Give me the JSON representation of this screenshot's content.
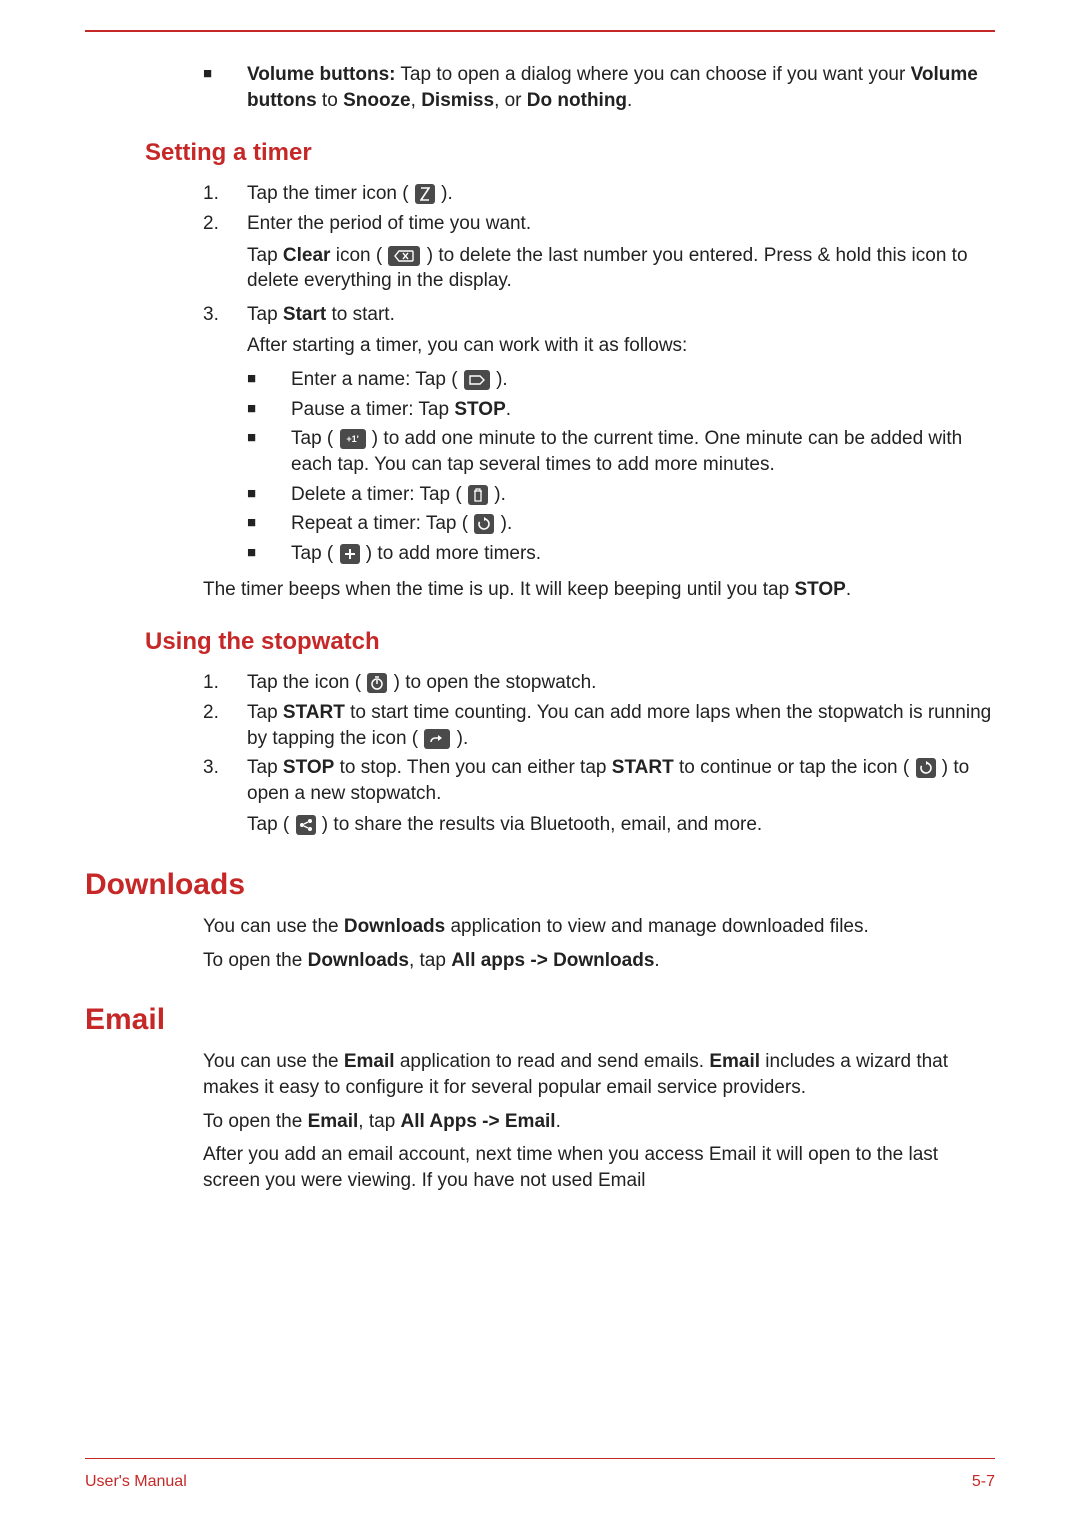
{
  "footer": {
    "left": "User's Manual",
    "right": "5-7"
  },
  "top_bullet": {
    "vb_bold": "Volume buttons:",
    "vb_text1": " Tap to open a dialog where you can choose if you want your ",
    "vb_text2_bold": "Volume buttons",
    "vb_text3": " to ",
    "vb_snooze": "Snooze",
    "vb_c1": ", ",
    "vb_dismiss": "Dismiss",
    "vb_c2": ", or ",
    "vb_donothing": "Do nothing",
    "vb_period": "."
  },
  "setting_timer": {
    "heading": "Setting a timer",
    "step1_a": "Tap the timer icon ( ",
    "step1_b": " ).",
    "step2": "Enter the period of time you want.",
    "step2_p_a": "Tap ",
    "step2_p_clear": "Clear",
    "step2_p_b": " icon ( ",
    "step2_p_c": " ) to delete the last number you entered. Press & hold this icon to delete everything in the display.",
    "step3_a": "Tap ",
    "step3_start": "Start",
    "step3_b": " to start.",
    "step3_p1": "After starting a timer, you can work with it as follows:",
    "b1_a": "Enter a name: Tap ( ",
    "b1_b": " ).",
    "b2_a": "Pause a timer: Tap ",
    "b2_stop": "STOP",
    "b2_b": ".",
    "b3_a": "Tap ( ",
    "b3_b": " ) to add one minute to the current time. One minute can be added with each tap. You can tap several times to add more minutes.",
    "b4_a": "Delete a timer: Tap ( ",
    "b4_b": " ).",
    "b5_a": "Repeat a timer: Tap ( ",
    "b5_b": " ).",
    "b6_a": "Tap ( ",
    "b6_b": " ) to add more timers.",
    "closing_a": "The timer beeps when the time is up. It will keep beeping until you tap ",
    "closing_stop": "STOP",
    "closing_b": "."
  },
  "stopwatch": {
    "heading": "Using the stopwatch",
    "s1_a": "Tap the icon ( ",
    "s1_b": " ) to open the stopwatch.",
    "s2_a": "Tap ",
    "s2_start": "START",
    "s2_b": " to start time counting. You can add more laps when the stopwatch is running by tapping the icon ( ",
    "s2_c": " ).",
    "s3_a": "Tap ",
    "s3_stop": "STOP",
    "s3_b": " to stop. Then you can either tap ",
    "s3_start": "START",
    "s3_c": " to continue or tap the icon ( ",
    "s3_d": " ) to open a new stopwatch.",
    "s3_p_a": "Tap ( ",
    "s3_p_b": " ) to share the results via Bluetooth, email, and more."
  },
  "downloads": {
    "heading": "Downloads",
    "p1_a": "You can use the ",
    "p1_dl": "Downloads",
    "p1_b": " application to view and manage downloaded files.",
    "p2_a": "To open the ",
    "p2_dl": "Downloads",
    "p2_b": ", tap ",
    "p2_path": "All apps -> Downloads",
    "p2_c": "."
  },
  "email": {
    "heading": "Email",
    "p1_a": "You can use the ",
    "p1_em": "Email",
    "p1_b": " application to read and send emails. ",
    "p1_em2": "Email",
    "p1_c": " includes a wizard that makes it easy to configure it for several popular email service providers.",
    "p2_a": "To open the ",
    "p2_em": "Email",
    "p2_b": ", tap ",
    "p2_path": "All Apps -> Email",
    "p2_c": ".",
    "p3": "After you add an email account, next time when you access Email it will open to the last screen you were viewing. If you have not used Email"
  }
}
